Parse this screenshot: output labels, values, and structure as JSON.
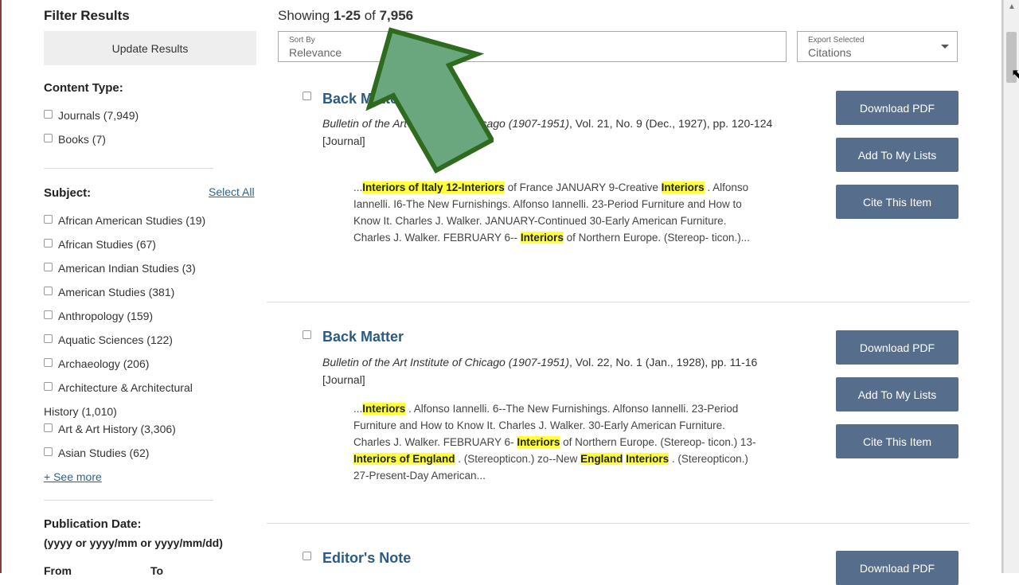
{
  "sidebar": {
    "title": "Filter Results",
    "update_label": "Update Results",
    "content_type": {
      "title": "Content Type:",
      "items": [
        {
          "label": "Journals (7,949)"
        },
        {
          "label": "Books (7)"
        }
      ]
    },
    "subject": {
      "title": "Subject:",
      "select_all": "Select All",
      "items": [
        {
          "label": "African American Studies (19)"
        },
        {
          "label": "African Studies (67)"
        },
        {
          "label": "American Indian Studies (3)"
        },
        {
          "label": "American Studies (381)"
        },
        {
          "label": "Anthropology (159)"
        },
        {
          "label": "Aquatic Sciences (122)"
        },
        {
          "label": "Archaeology (206)"
        },
        {
          "label": "Architecture & Architectural"
        },
        {
          "label": "Art & Art History (3,306)"
        },
        {
          "label": "Asian Studies (62)"
        }
      ],
      "wrap_line": "History (1,010)",
      "see_more": "+ See more"
    },
    "pub_date": {
      "title": "Publication Date:",
      "format": "(yyyy or yyyy/mm or yyyy/mm/dd)",
      "from_label": "From",
      "to_label": "To"
    }
  },
  "main": {
    "showing_prefix": "Showing ",
    "showing_range": "1-25",
    "showing_of": " of ",
    "showing_total": "7,956",
    "sort": {
      "label": "Sort By",
      "value": "Relevance"
    },
    "export": {
      "label": "Export Selected",
      "value": "Citations"
    },
    "results": [
      {
        "title": "Back Matter",
        "journal": "Bulletin of the Art Institute of Chicago (1907-1951)",
        "details": ", Vol. 21, No. 9 (Dec., 1927), pp. 120-124",
        "type": "[Journal]",
        "snippet": [
          {
            "t": "...",
            "h": false
          },
          {
            "t": "Interiors of Italy 12-Interiors",
            "h": true
          },
          {
            "t": " of France JANUARY 9-Creative ",
            "h": false
          },
          {
            "t": "Interiors",
            "h": true
          },
          {
            "t": " . Alfonso Iannelli. I6-The New Furnishings. Alfonso Iannelli. 23-Period Furniture and How to Know It. Charles J. Walker. JANUARY-Continued 30-Early American Furniture. Charles J. Walker. FEBRUARY 6-- ",
            "h": false
          },
          {
            "t": "Interiors",
            "h": true
          },
          {
            "t": " of Northern Europe. (Stereop- ticon.)...",
            "h": false
          }
        ]
      },
      {
        "title": "Back Matter",
        "journal": "Bulletin of the Art Institute of Chicago (1907-1951)",
        "details": ", Vol. 22, No. 1 (Jan., 1928), pp. 11-16",
        "type": "[Journal]",
        "snippet": [
          {
            "t": "...",
            "h": false
          },
          {
            "t": "Interiors",
            "h": true
          },
          {
            "t": " . Alfonso Iannelli. 6--The New Furnishings. Alfonso Iannelli. 23-Period Furniture and How to Know It. Charles J. Walker. 30-Early American Furniture. Charles J. Walker. FEBRUARY 6- ",
            "h": false
          },
          {
            "t": "Interiors",
            "h": true
          },
          {
            "t": " of Northern Europe. (Stereop- ticon.) 13- ",
            "h": false
          },
          {
            "t": "Interiors of England",
            "h": true
          },
          {
            "t": " . (Stereopticon.) zo--New ",
            "h": false
          },
          {
            "t": "England",
            "h": true
          },
          {
            "t": " ",
            "h": false
          },
          {
            "t": "Interiors",
            "h": true
          },
          {
            "t": " . (Stereopticon.) 27-Present-Day American...",
            "h": false
          }
        ]
      },
      {
        "title": "Editor's Note"
      }
    ],
    "buttons": {
      "download": "Download PDF",
      "add_list": "Add To My Lists",
      "cite": "Cite This Item"
    }
  },
  "colors": {
    "button_bg": "#576d8c",
    "title_link": "#2b5a84",
    "highlight": "#ffff3a",
    "arrow_fill": "#6aa77e",
    "arrow_stroke": "#2e6b1f"
  }
}
